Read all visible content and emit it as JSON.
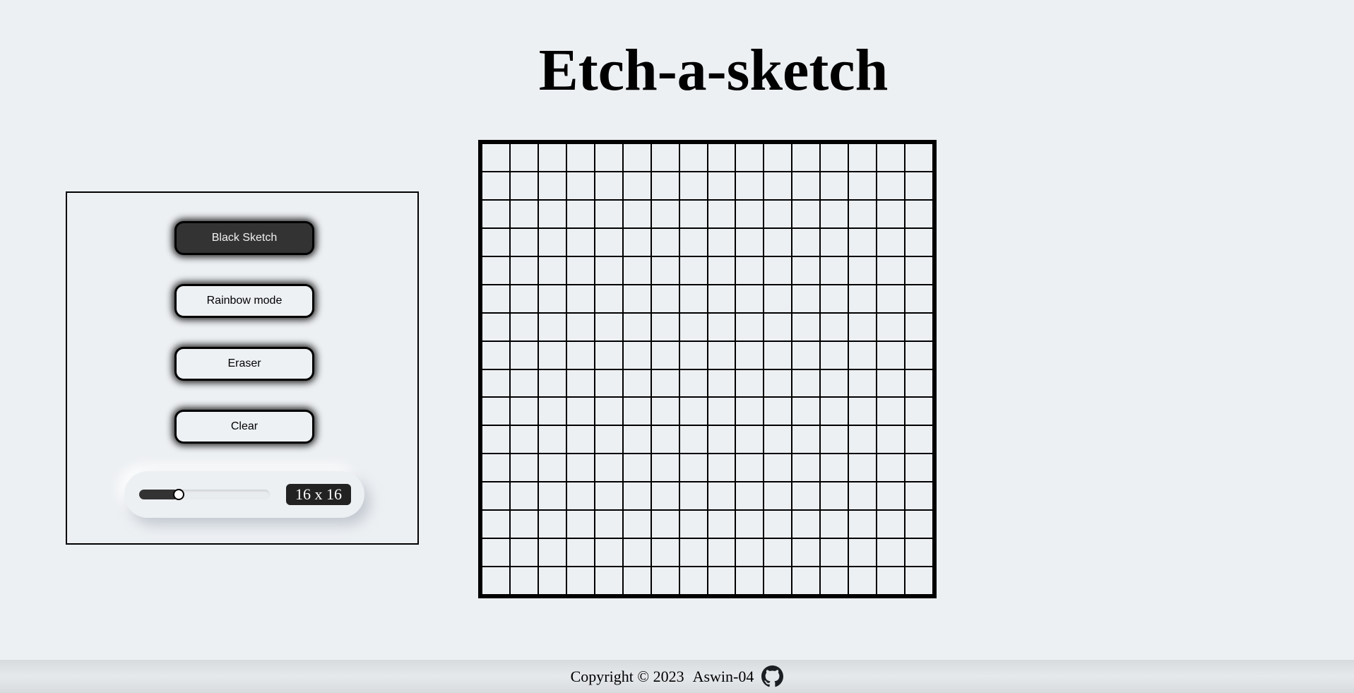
{
  "page": {
    "title": "Etch-a-sketch"
  },
  "controls": {
    "buttons": [
      {
        "label": "Black Sketch",
        "active": true
      },
      {
        "label": "Rainbow mode",
        "active": false
      },
      {
        "label": "Eraser",
        "active": false
      },
      {
        "label": "Clear",
        "active": false
      }
    ],
    "grid_size_slider": {
      "value": 16,
      "min": 2,
      "max": 100,
      "label": "16 x 16"
    }
  },
  "grid": {
    "rows": 16,
    "cols": 16
  },
  "footer": {
    "copyright": "Copyright © 2023",
    "author": "Aswin-04",
    "icon": "github-icon"
  },
  "colors": {
    "background": "#edf0f3",
    "active_button": "#333333",
    "border": "#000000"
  }
}
